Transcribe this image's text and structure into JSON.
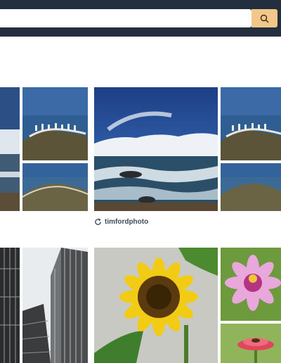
{
  "search": {
    "value": "",
    "placeholder": ""
  },
  "icons": {
    "search": "search-icon",
    "credit": "refresh-icon"
  },
  "colors": {
    "topbar": "#232f3e",
    "search_button": "#f3c68a",
    "credit_text": "#3d4b5c"
  },
  "collections": [
    {
      "credit": "timfordphoto"
    }
  ]
}
